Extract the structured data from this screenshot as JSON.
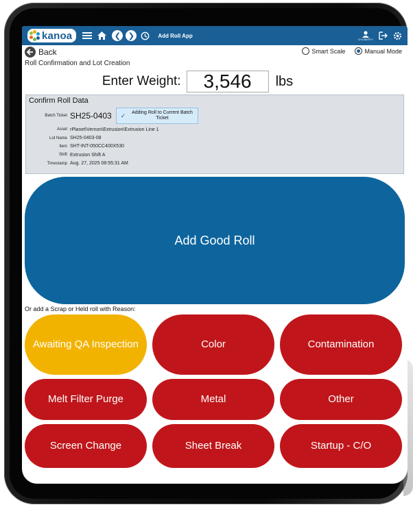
{
  "topbar": {
    "logo_text": "kanoa",
    "app_title": "Add Roll App",
    "user_name": "DYUSERTY",
    "brand_color": "#1a5f96",
    "icons": [
      "menu-icon",
      "home-icon",
      "back-circle-icon",
      "forward-circle-icon",
      "history-icon",
      "user-icon",
      "logout-icon",
      "settings-icon"
    ]
  },
  "nav": {
    "back_label": "Back",
    "modes": [
      {
        "label": "Smart Scale",
        "selected": false
      },
      {
        "label": "Manual Mode",
        "selected": true
      }
    ]
  },
  "page": {
    "subtitle": "Roll Confirmation and Lot Creation"
  },
  "weight": {
    "label": "Enter Weight:",
    "value": "3,546",
    "unit": "lbs"
  },
  "confirm": {
    "title": "Confirm Roll Data",
    "batch_ticket_label": "Batch Ticket",
    "batch_ticket_value": "SH25-0403",
    "adding_note": "Adding Roll to Current Batch Ticket",
    "fields": [
      {
        "label": "Asset",
        "value": "rPlanet\\Vernon\\Extrusion\\Extrusion Line 1"
      },
      {
        "label": "Lot Name",
        "value": "SH25-0403-08"
      },
      {
        "label": "Item",
        "value": "SHT-INT-050CC400X530"
      },
      {
        "label": "Shift",
        "value": "Extrusion Shift A"
      },
      {
        "label": "Timestamp",
        "value": "Aug. 27, 2025 08:55:31 AM"
      }
    ]
  },
  "good_roll": {
    "label": "Add Good Roll",
    "color": "#0e659d"
  },
  "reasons": {
    "prompt": "Or add a Scrap or Held roll with Reason:",
    "scrap_color": "#c0161b",
    "held_color": "#f2b300",
    "items": [
      "Awaiting QA Inspection",
      "Color",
      "Contamination",
      "Melt Filter Purge",
      "Metal",
      "Other",
      "Screen Change",
      "Sheet Break",
      "Startup - C/O"
    ]
  }
}
